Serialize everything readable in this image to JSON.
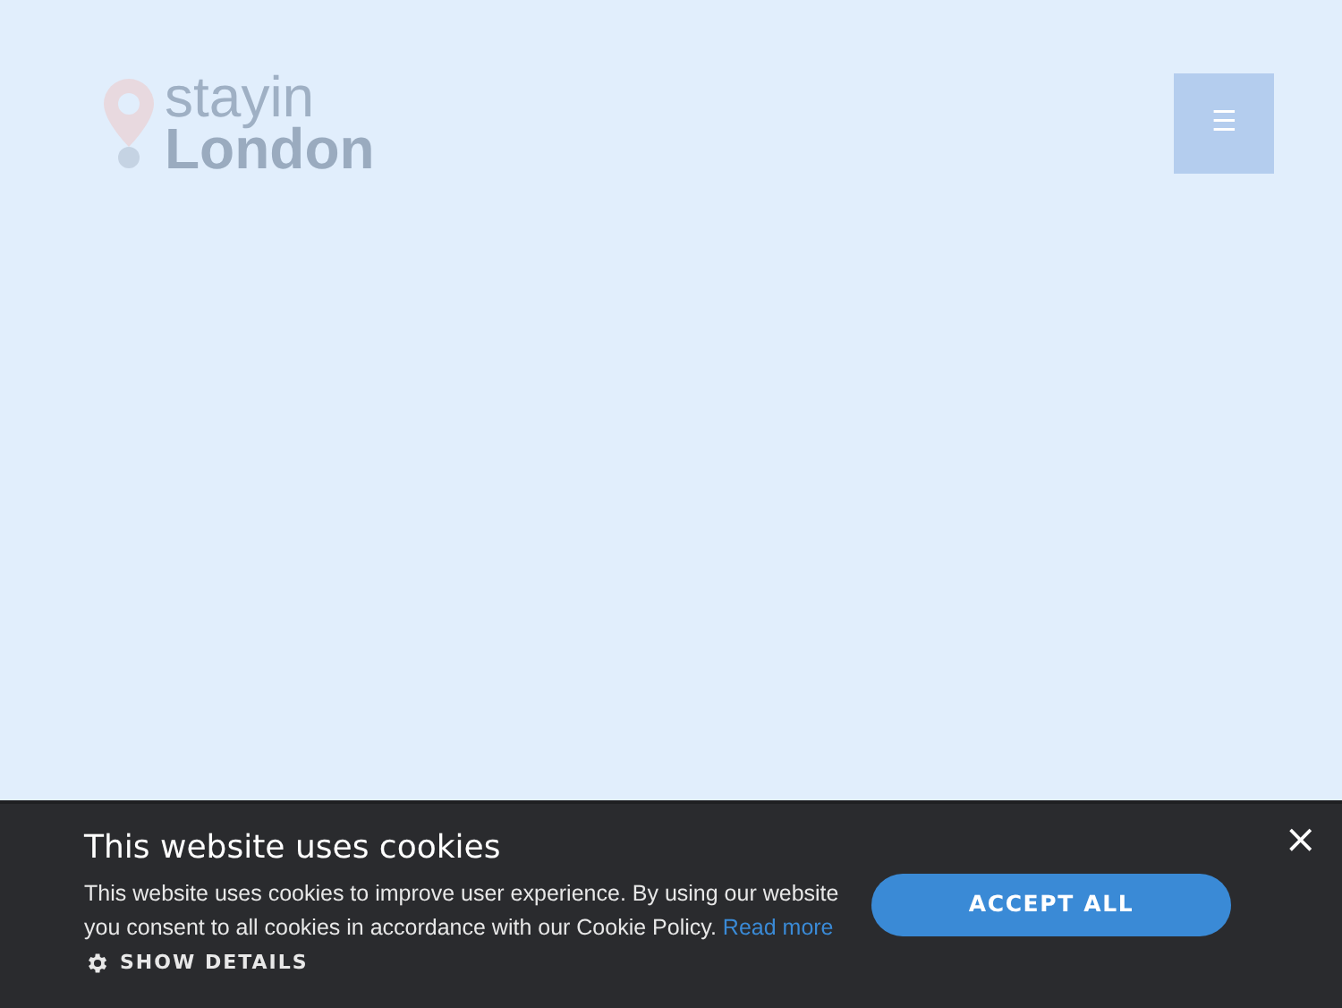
{
  "logo": {
    "line_1": "stayin",
    "line_2": "London"
  },
  "menu_button": {
    "label": "☰"
  },
  "cookie_banner": {
    "title": "This website uses cookies",
    "text": "This website uses cookies to improve user experience. By using our website you consent to all cookies in accordance with our Cookie Policy.",
    "link": "Read more",
    "details": "SHOW DETAILS",
    "accept": "ACCEPT ALL",
    "close": "×"
  }
}
